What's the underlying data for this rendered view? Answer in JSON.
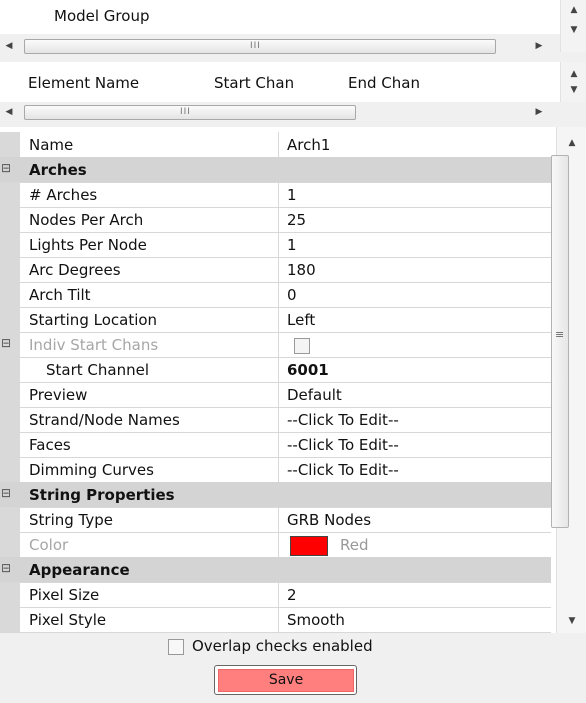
{
  "model_groups": {
    "item_label": "Model Group",
    "scroll_grip": "III"
  },
  "element_list": {
    "columns": [
      "Element Name",
      "Start Chan",
      "End Chan"
    ],
    "scroll_grip": "III"
  },
  "property_grid": {
    "rows": [
      {
        "type": "prop",
        "key": "Name",
        "value": "Arch1"
      },
      {
        "type": "cat",
        "key": "Arches"
      },
      {
        "type": "prop",
        "key": "# Arches",
        "value": "1"
      },
      {
        "type": "prop",
        "key": "Nodes Per Arch",
        "value": "25"
      },
      {
        "type": "prop",
        "key": "Lights Per Node",
        "value": "1"
      },
      {
        "type": "prop",
        "key": "Arc Degrees",
        "value": "180"
      },
      {
        "type": "prop",
        "key": "Arch Tilt",
        "value": "0"
      },
      {
        "type": "prop",
        "key": "Starting Location",
        "value": "Left"
      },
      {
        "type": "prop",
        "key": "Indiv Start Chans",
        "value": ""
      },
      {
        "type": "prop",
        "key": "Start Channel",
        "value": "6001"
      },
      {
        "type": "prop",
        "key": "Preview",
        "value": "Default"
      },
      {
        "type": "prop",
        "key": "Strand/Node Names",
        "value": "--Click To Edit--"
      },
      {
        "type": "prop",
        "key": "Faces",
        "value": "--Click To Edit--"
      },
      {
        "type": "prop",
        "key": "Dimming Curves",
        "value": "--Click To Edit--"
      },
      {
        "type": "cat",
        "key": "String Properties"
      },
      {
        "type": "prop",
        "key": "String Type",
        "value": "GRB Nodes"
      },
      {
        "type": "prop",
        "key": "Color",
        "value": "Red"
      },
      {
        "type": "cat",
        "key": "Appearance"
      },
      {
        "type": "prop",
        "key": "Pixel Size",
        "value": "2"
      },
      {
        "type": "prop",
        "key": "Pixel Style",
        "value": "Smooth"
      }
    ],
    "color_swatch": "#ff0000",
    "scroll_grip": "≡"
  },
  "overlap_checks": {
    "label": "Overlap checks enabled",
    "checked": false
  },
  "save_button": {
    "label": "Save",
    "color": "#ff7f7f"
  }
}
